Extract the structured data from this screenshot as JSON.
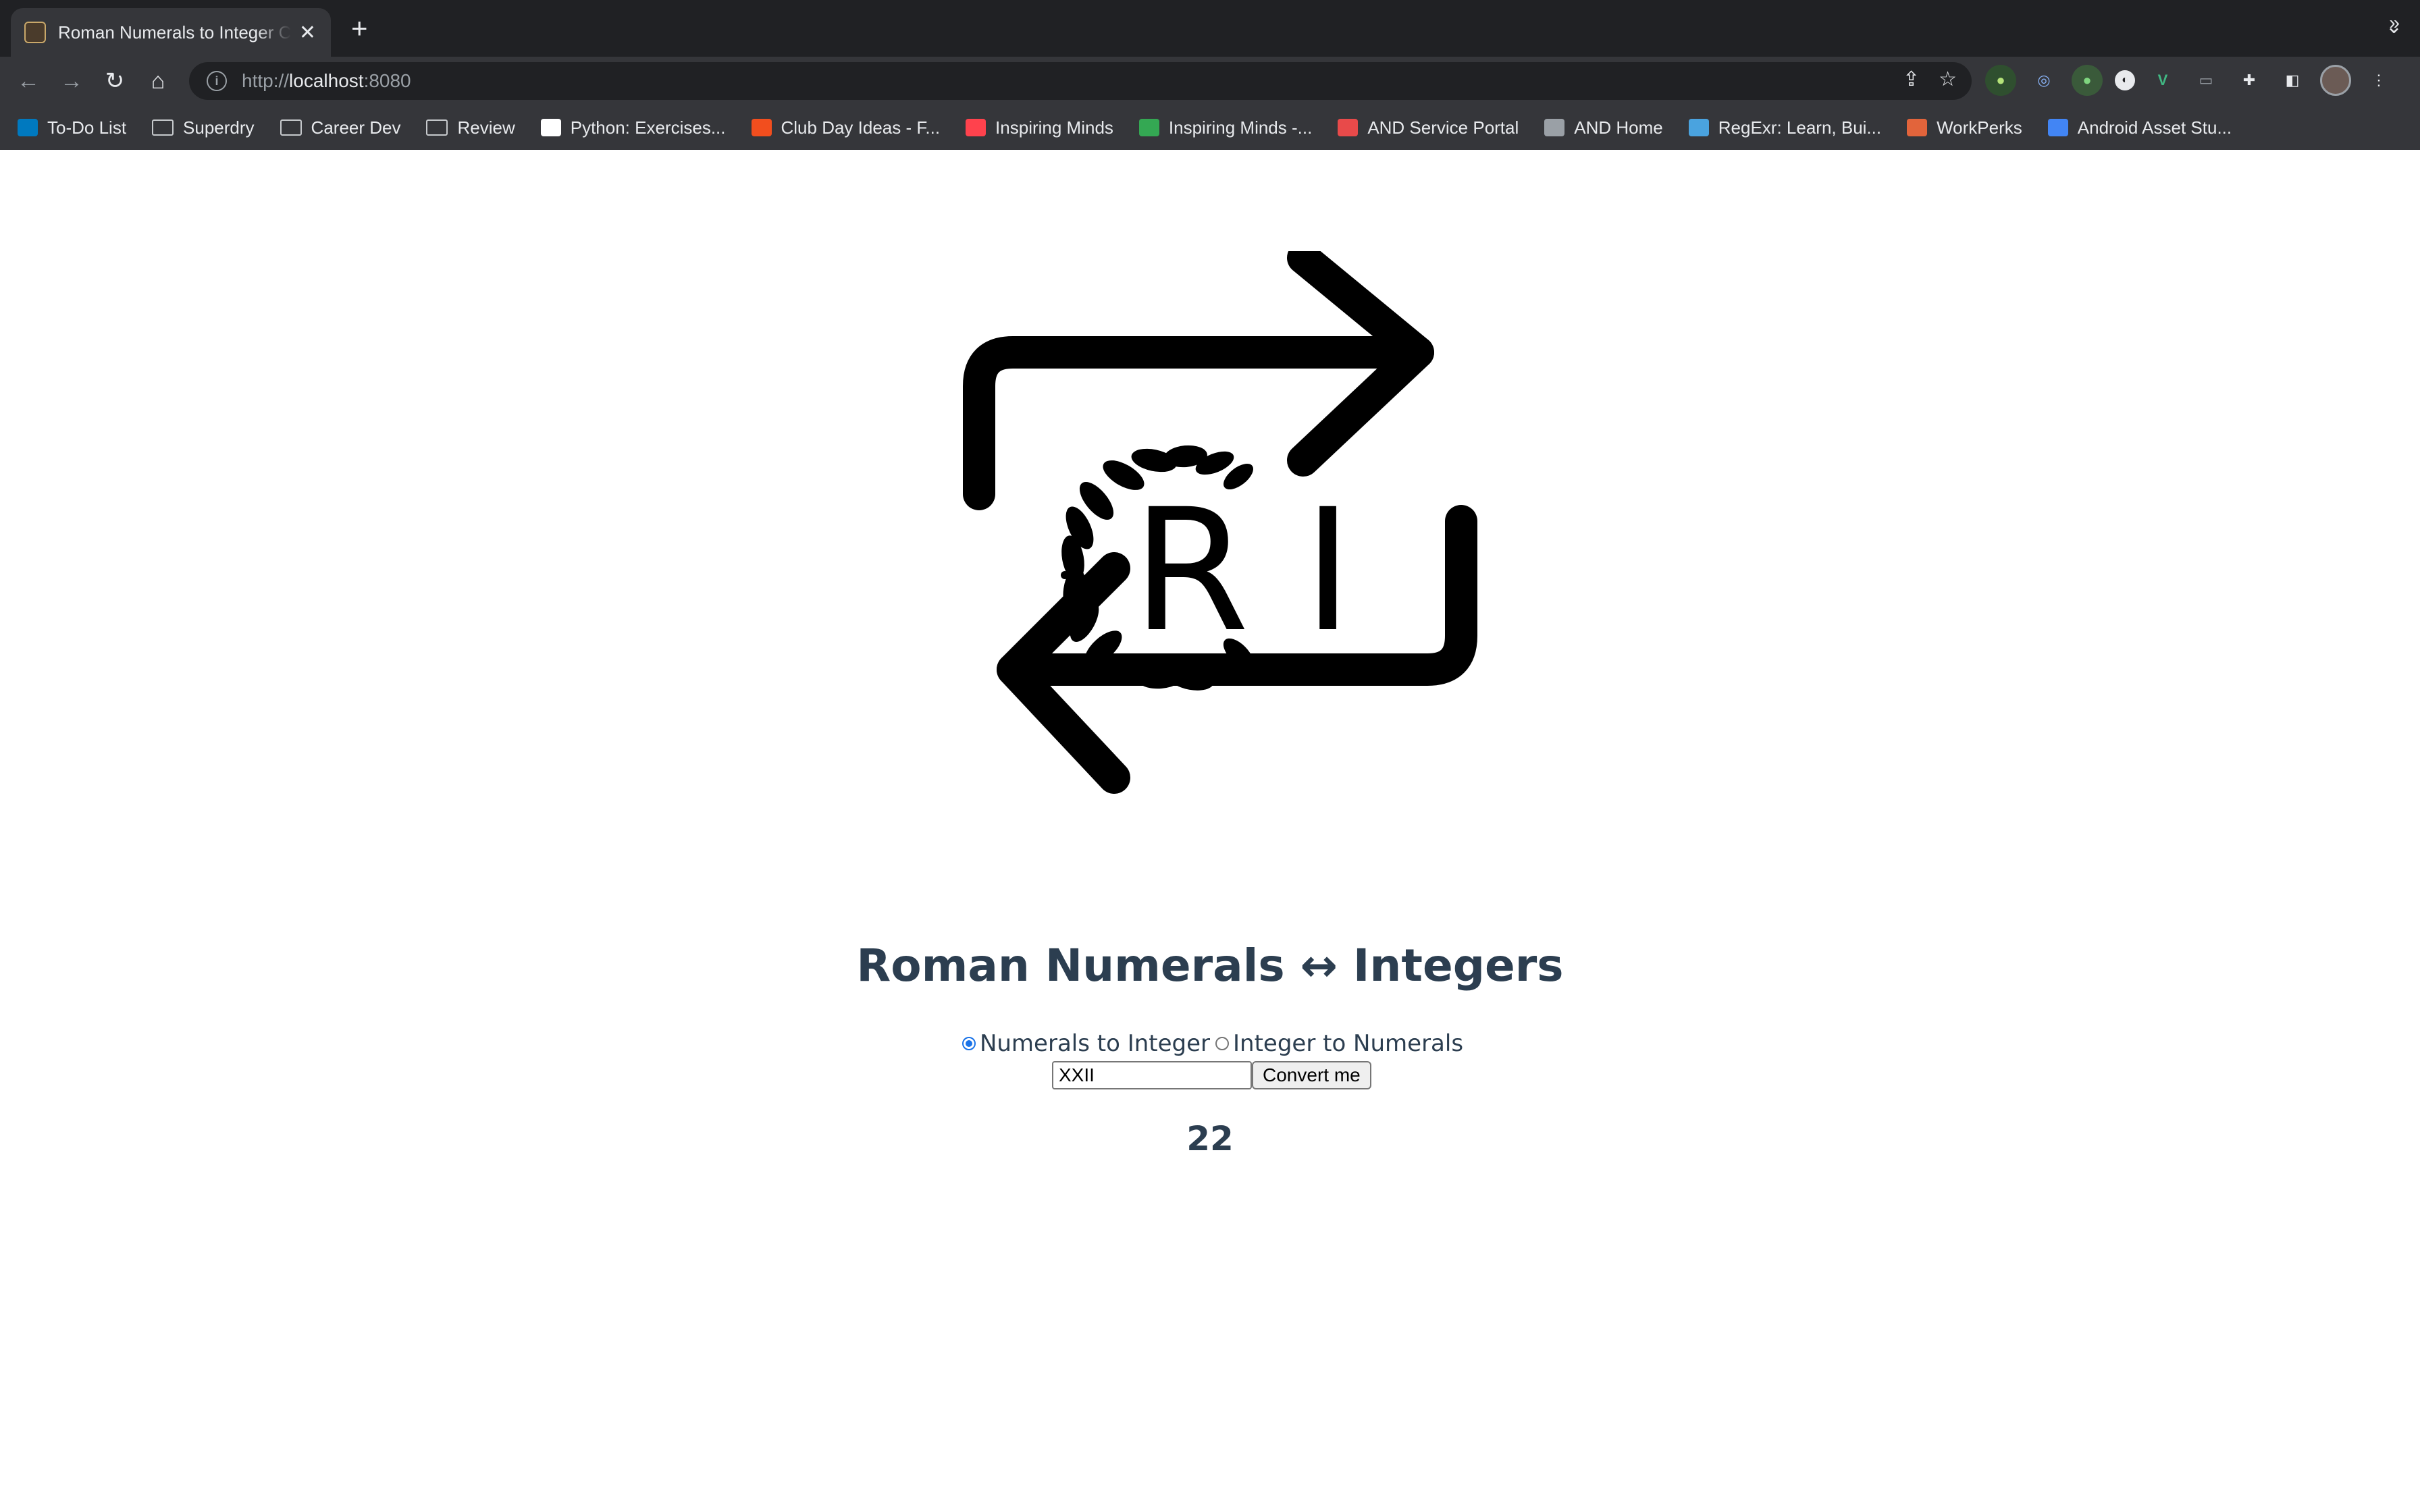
{
  "browser": {
    "tab": {
      "title": "Roman Numerals to Integer Converter"
    },
    "url": {
      "scheme": "http://",
      "host": "localhost",
      "port": ":8080"
    },
    "bookmarks": [
      {
        "label": "To-Do List",
        "icon": "trello-icon",
        "color": "#0079bf"
      },
      {
        "label": "Superdry",
        "icon": "folder-icon"
      },
      {
        "label": "Career Dev",
        "icon": "folder-icon"
      },
      {
        "label": "Review",
        "icon": "folder-icon"
      },
      {
        "label": "Python: Exercises...",
        "icon": "medium-icon",
        "color": "#ffffff"
      },
      {
        "label": "Club Day Ideas - F...",
        "icon": "figma-icon",
        "color": "#f24e1e"
      },
      {
        "label": "Inspiring Minds",
        "icon": "patreon-icon",
        "color": "#ff424d"
      },
      {
        "label": "Inspiring Minds -...",
        "icon": "google-drive-icon",
        "color": "#34a853"
      },
      {
        "label": "AND Service Portal",
        "icon": "portal-icon",
        "color": "#e84a4a"
      },
      {
        "label": "AND Home",
        "icon": "globe-icon",
        "color": "#9aa0a6"
      },
      {
        "label": "RegExr: Learn, Bui...",
        "icon": "regexr-icon",
        "color": "#4aa3df"
      },
      {
        "label": "WorkPerks",
        "icon": "workperks-icon",
        "color": "#e2643b"
      },
      {
        "label": "Android Asset Stu...",
        "icon": "android-asset-icon",
        "color": "#4285f4"
      }
    ]
  },
  "app": {
    "heading": "Roman Numerals ↔ Integers",
    "modes": [
      {
        "label": "Numerals to Integer",
        "selected": true
      },
      {
        "label": "Integer to Numerals",
        "selected": false
      }
    ],
    "input_value": "XXII",
    "convert_label": "Convert me",
    "result": "22",
    "logo_letters": "R I"
  }
}
